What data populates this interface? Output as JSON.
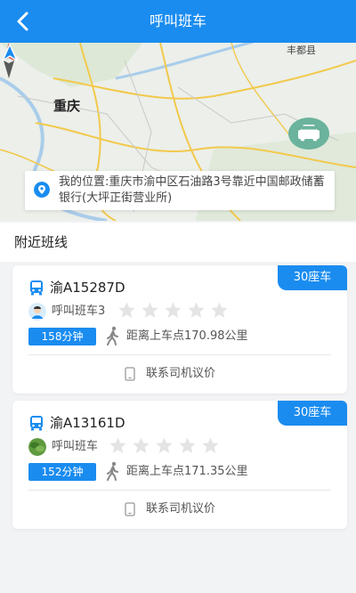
{
  "header": {
    "title": "呼叫班车",
    "back_icon": "back-arrow-icon"
  },
  "map": {
    "city_label": "重庆",
    "town_label": "丰都县",
    "car_marker_icon": "car-icon"
  },
  "location": {
    "text": "我的位置:重庆市渝中区石油路3号靠近中国邮政储蓄银行(大坪正街营业所)"
  },
  "section": {
    "title": "附近班线"
  },
  "routes": [
    {
      "seat_tag": "30座车",
      "plate": "渝A15287D",
      "driver": "呼叫班车3",
      "rating": 0,
      "time": "158分钟",
      "distance": "距离上车点170.98公里",
      "contact": "联系司机议价"
    },
    {
      "seat_tag": "30座车",
      "plate": "渝A13161D",
      "driver": "呼叫班车",
      "rating": 0,
      "time": "152分钟",
      "distance": "距离上车点171.35公里",
      "contact": "联系司机议价"
    }
  ],
  "colors": {
    "primary": "#1a8cf0",
    "star_empty": "#e4e4e4",
    "car_marker": "#6bb39c"
  }
}
